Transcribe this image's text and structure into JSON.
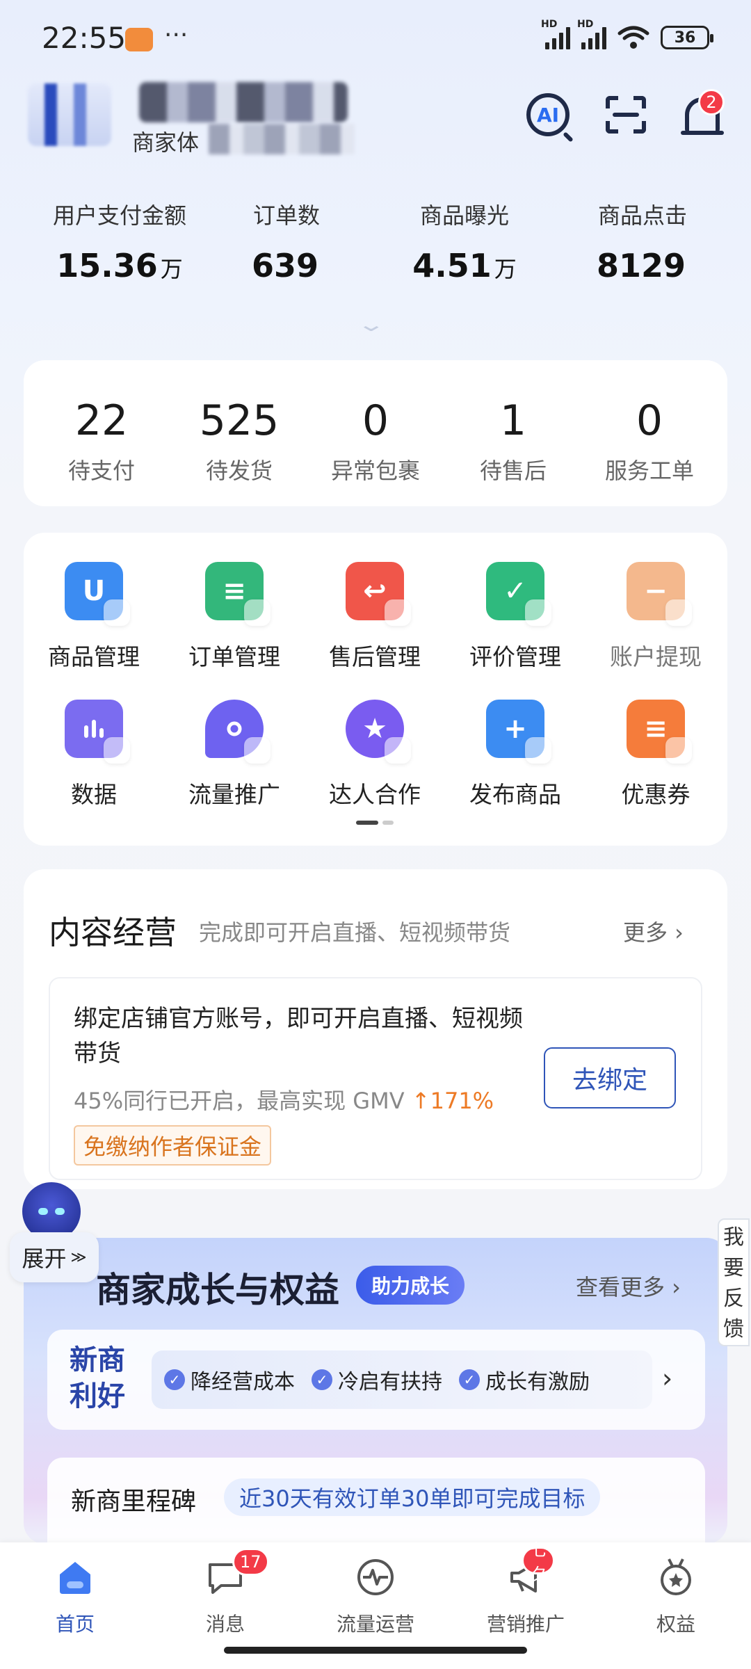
{
  "status_bar": {
    "time": "22:55",
    "dots": "···",
    "signal_1_label": "HD",
    "signal_2_label": "HD",
    "battery": "36"
  },
  "header": {
    "shop_subtitle_prefix": "商家体",
    "bell_badge": "2",
    "ai_label": "AI"
  },
  "stats": [
    {
      "label": "用户支付金额",
      "value": "15.36",
      "unit": "万"
    },
    {
      "label": "订单数",
      "value": "639",
      "unit": ""
    },
    {
      "label": "商品曝光",
      "value": "4.51",
      "unit": "万"
    },
    {
      "label": "商品点击",
      "value": "8129",
      "unit": ""
    }
  ],
  "orders": [
    {
      "count": "22",
      "label": "待支付"
    },
    {
      "count": "525",
      "label": "待发货"
    },
    {
      "count": "0",
      "label": "异常包裹"
    },
    {
      "count": "1",
      "label": "待售后"
    },
    {
      "count": "0",
      "label": "服务工单"
    }
  ],
  "tools": [
    {
      "label": "商品管理",
      "icon": "shopping-bag-icon",
      "color": "#3c8cf2",
      "glyph": "U"
    },
    {
      "label": "订单管理",
      "icon": "order-list-icon",
      "color": "#33b77b",
      "glyph": "≡"
    },
    {
      "label": "售后管理",
      "icon": "return-icon",
      "color": "#f0564a",
      "glyph": "↩"
    },
    {
      "label": "评价管理",
      "icon": "check-review-icon",
      "color": "#2fba7e",
      "glyph": "✓"
    },
    {
      "label": "账户提现",
      "icon": "wallet-icon",
      "color": "#f4b88d",
      "glyph": "−"
    },
    {
      "label": "数据",
      "icon": "bar-chart-icon",
      "color": "#7b6cf0",
      "glyph": "▮"
    },
    {
      "label": "流量推广",
      "icon": "rocket-icon",
      "color": "#6e62f0",
      "glyph": "➶"
    },
    {
      "label": "达人合作",
      "icon": "star-badge-icon",
      "color": "#7a5cf0",
      "glyph": "★"
    },
    {
      "label": "发布商品",
      "icon": "plus-icon",
      "color": "#3c8cf2",
      "glyph": "+"
    },
    {
      "label": "优惠券",
      "icon": "coupon-icon",
      "color": "#f57c3b",
      "glyph": "≡"
    }
  ],
  "content": {
    "title": "内容经营",
    "subtitle": "完成即可开启直播、短视频带货",
    "more": "更多 ›",
    "bind_text": "绑定店铺官方账号，即可开启直播、短视频带货",
    "bind_stat": "45%同行已开启，最高实现 GMV ",
    "bind_stat_up": "↑171%",
    "bind_tag": "免缴纳作者保证金",
    "bind_button": "去绑定"
  },
  "float": {
    "expand": "展开",
    "feedback": "我要反馈"
  },
  "growth": {
    "title": "商家成长与权益",
    "pill": "助力成长",
    "more": "查看更多 ›",
    "benefit_title": "新商利好",
    "chips": [
      "降经营成本",
      "冷启有扶持",
      "成长有激励"
    ],
    "milestone_title": "新商里程碑",
    "milestone_tag": "近30天有效订单30单即可完成目标"
  },
  "nav": [
    {
      "label": "首页",
      "icon": "home-icon",
      "badge": ""
    },
    {
      "label": "消息",
      "icon": "message-icon",
      "badge": "17"
    },
    {
      "label": "流量运营",
      "icon": "pulse-icon",
      "badge": ""
    },
    {
      "label": "营销推广",
      "icon": "megaphone-icon",
      "badge": "七夕"
    },
    {
      "label": "权益",
      "icon": "medal-icon",
      "badge": ""
    }
  ],
  "colors": {
    "accent": "#2f55b8",
    "badge": "#f33a47",
    "highlight": "#ed7a25"
  }
}
